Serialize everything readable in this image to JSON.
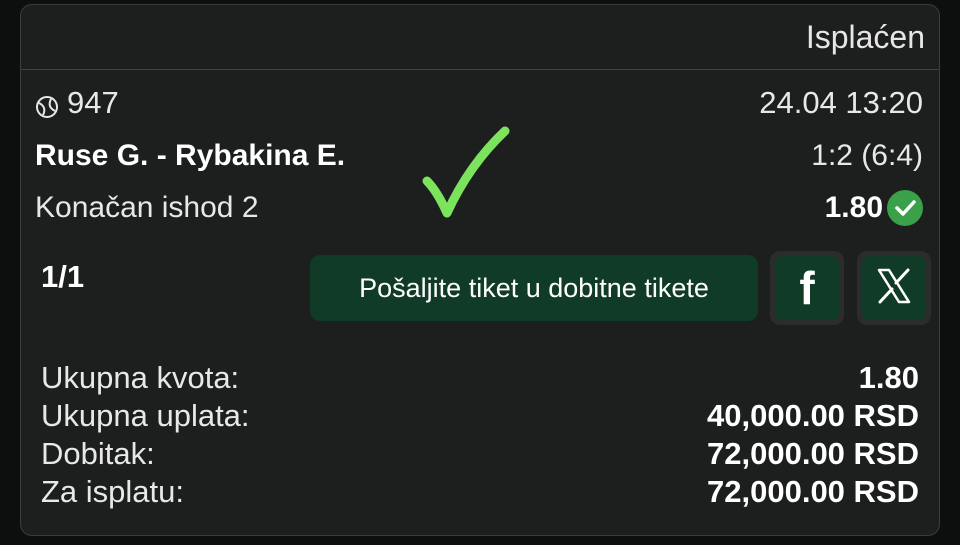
{
  "ticket": {
    "status": "Isplaćen",
    "event_code": "947",
    "datetime": "24.04 13:20",
    "match": "Ruse G. - Rybakina E.",
    "score": "1:2 (6:4)",
    "market": "Konačan ishod 2",
    "odd": "1.80",
    "count": "1/1",
    "sport_icon": "tennis-ball-icon",
    "win_check_icon": "check-circle-icon"
  },
  "actions": {
    "send_label": "Pošaljite tiket u dobitne tikete",
    "facebook_icon": "facebook-icon",
    "x_icon": "x-icon"
  },
  "summary": [
    {
      "label": "Ukupna kvota:",
      "value": "1.80"
    },
    {
      "label": "Ukupna uplata:",
      "value": "40,000.00 RSD"
    },
    {
      "label": "Dobitak:",
      "value": "72,000.00 RSD"
    },
    {
      "label": "Za isplatu:",
      "value": "72,000.00 RSD"
    }
  ],
  "colors": {
    "background": "#1c1f1e",
    "accent_green": "#3aa14a",
    "button_green": "#103b27",
    "big_check": "#7be35c"
  }
}
